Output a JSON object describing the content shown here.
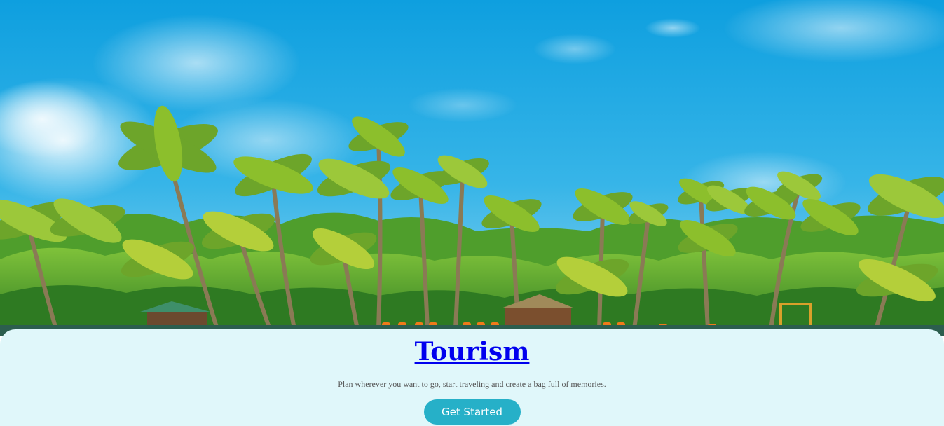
{
  "hero": {
    "image_icon": "beach-palm-trees-image",
    "sky_color": "#1aa6e0",
    "foliage_color": "#3f9a2a"
  },
  "content": {
    "title": "Tourism",
    "tagline": "Plan wherever you want to go, start traveling and create a bag full of memories.",
    "cta_label": "Get Started"
  },
  "colors": {
    "panel_bg": "#e0f7fa",
    "title_link": "#0000ee",
    "tagline": "#555555",
    "cta_bg": "#26b0c8",
    "cta_text": "#ffffff"
  }
}
